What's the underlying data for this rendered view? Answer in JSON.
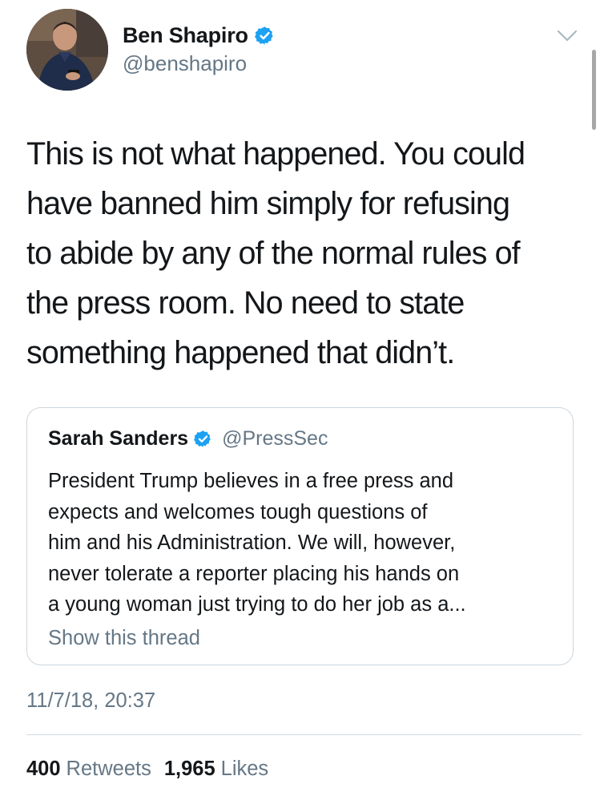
{
  "author": {
    "display_name": "Ben Shapiro",
    "handle": "@benshapiro",
    "verified": true
  },
  "tweet": {
    "text_lines": [
      "This is not what happened. You could",
      "have banned him simply for refusing",
      "to abide by any of the normal rules of",
      "the press room. No need to state",
      "something happened that didn’t."
    ]
  },
  "quoted_tweet": {
    "display_name": "Sarah Sanders",
    "handle": "@PressSec",
    "verified": true,
    "text_lines": [
      "President Trump believes in a free press and",
      "expects and welcomes tough questions of",
      "him and his Administration. We will, however,",
      "never tolerate a reporter placing his hands on",
      "a young woman just trying to do her job as a..."
    ],
    "show_thread_label": "Show this thread"
  },
  "timestamp": "11/7/18, 20:37",
  "stats": {
    "retweets_count": "400",
    "retweets_label": "Retweets",
    "likes_count": "1,965",
    "likes_label": "Likes"
  },
  "icons": {
    "verified": "verified-badge-icon",
    "menu": "chevron-down-icon"
  },
  "colors": {
    "verified_blue": "#1da1f2",
    "secondary_text": "#657786",
    "primary_text": "#14171a",
    "border": "#ccd6dd"
  }
}
